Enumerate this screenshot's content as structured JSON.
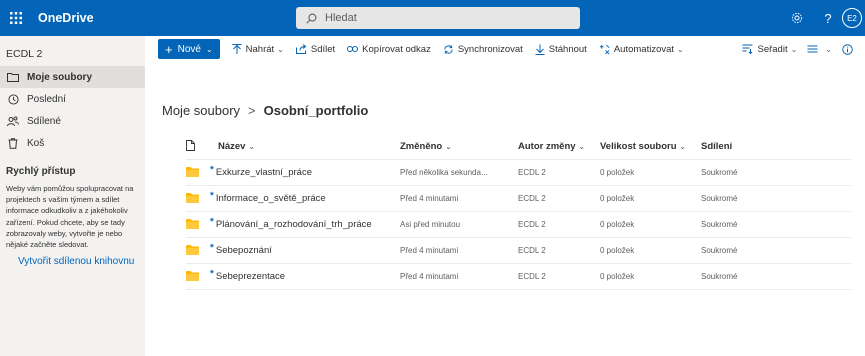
{
  "topbar": {
    "app_name": "OneDrive",
    "search_placeholder": "Hledat",
    "avatar_initials": "E2",
    "help_label": "?"
  },
  "sidebar": {
    "user": "ECDL 2",
    "items": [
      {
        "label": "Moje soubory",
        "icon": "folder-icon",
        "active": true
      },
      {
        "label": "Poslední",
        "icon": "clock-icon"
      },
      {
        "label": "Sdílené",
        "icon": "people-icon"
      },
      {
        "label": "Koš",
        "icon": "trash-icon"
      }
    ],
    "quick_access_title": "Rychlý přístup",
    "quick_access_text": "Weby vám pomůžou spolupracovat na projektech s vaším týmem a sdílet informace odkudkoliv a z jakéhokoliv zařízení. Pokud chcete, aby se tady zobrazovaly weby, vytvořte je nebo nějaké začněte sledovat.",
    "create_link": "Vytvořit sdílenou knihovnu"
  },
  "commandbar": {
    "new": "Nové",
    "upload": "Nahrát",
    "share": "Sdílet",
    "copy_link": "Kopírovat odkaz",
    "sync": "Synchronizovat",
    "download": "Stáhnout",
    "automate": "Automatizovat",
    "sort": "Seřadit"
  },
  "breadcrumb": {
    "root": "Moje soubory",
    "separator": ">",
    "current": "Osobní_portfolio"
  },
  "table": {
    "headers": {
      "name": "Název",
      "modified": "Změněno",
      "modified_by": "Autor změny",
      "size": "Velikost souboru",
      "sharing": "Sdílení"
    },
    "rows": [
      {
        "name": "Exkurze_vlastní_práce",
        "modified": "Před několika sekunda...",
        "by": "ECDL 2",
        "size": "0 položek",
        "sharing": "Soukromé"
      },
      {
        "name": "Informace_o_světě_práce",
        "modified": "Před 4 minutami",
        "by": "ECDL 2",
        "size": "0 položek",
        "sharing": "Soukromé"
      },
      {
        "name": "Plánování_a_rozhodování_trh_práce",
        "modified": "Asi před minutou",
        "by": "ECDL 2",
        "size": "0 položek",
        "sharing": "Soukromé"
      },
      {
        "name": "Sebepoznání",
        "modified": "Před 4 minutami",
        "by": "ECDL 2",
        "size": "0 položek",
        "sharing": "Soukromé"
      },
      {
        "name": "Sebeprezentace",
        "modified": "Před 4 minutami",
        "by": "ECDL 2",
        "size": "0 položek",
        "sharing": "Soukromé"
      }
    ]
  },
  "colors": {
    "brand": "#0364b8",
    "folder": "#ffb900",
    "sidebar_bg": "#f3f2f1"
  }
}
